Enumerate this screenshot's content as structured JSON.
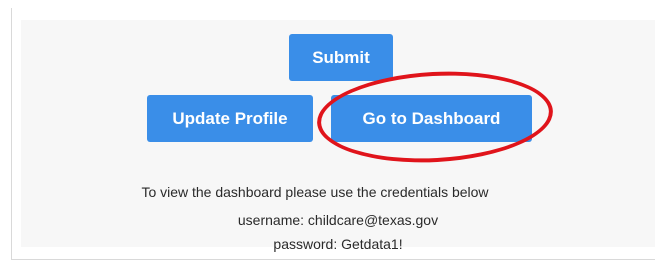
{
  "buttons": {
    "submit_label": "Submit",
    "update_profile_label": "Update Profile",
    "dashboard_label": "Go to Dashboard"
  },
  "info": {
    "instructions": "To view the dashboard please use the credentials below",
    "username_line": "username: childcare@texas.gov",
    "password_line": "password: Getdata1!"
  },
  "colors": {
    "button_blue": "#3a8ee8",
    "highlight_red": "#e0141b",
    "panel_bg": "#f7f7f7"
  },
  "annotation": {
    "highlight_target": "dashboard-button"
  }
}
